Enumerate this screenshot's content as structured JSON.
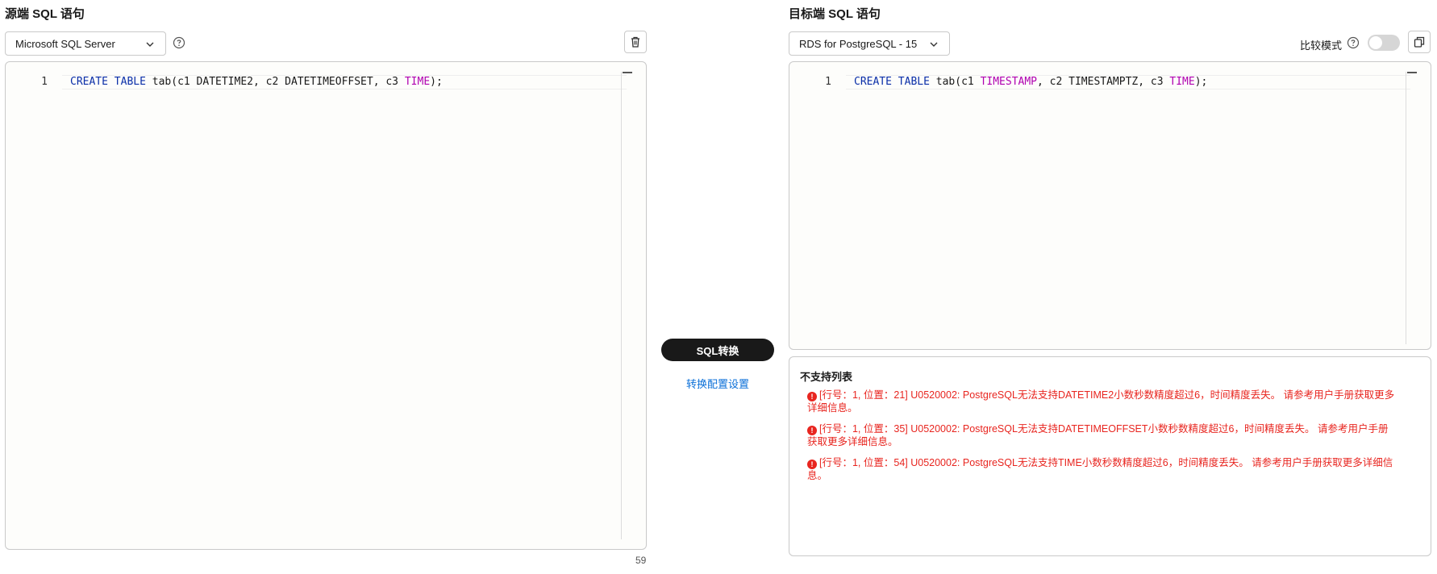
{
  "source": {
    "title": "源端 SQL 语句",
    "db_select": "Microsoft SQL Server",
    "line_number": "1",
    "code_tokens": [
      {
        "text": "CREATE",
        "kind": "kw"
      },
      {
        "text": " ",
        "kind": "plain"
      },
      {
        "text": "TABLE",
        "kind": "kw"
      },
      {
        "text": " tab(c1 DATETIME2, c2 DATETIMEOFFSET, c3 ",
        "kind": "plain"
      },
      {
        "text": "TIME",
        "kind": "type"
      },
      {
        "text": ");",
        "kind": "plain"
      }
    ],
    "char_count": "59"
  },
  "target": {
    "title": "目标端 SQL 语句",
    "db_select": "RDS for PostgreSQL - 15",
    "compare_mode_label": "比较模式",
    "compare_mode_on": false,
    "line_number": "1",
    "code_tokens": [
      {
        "text": "CREATE",
        "kind": "kw"
      },
      {
        "text": " ",
        "kind": "plain"
      },
      {
        "text": "TABLE",
        "kind": "kw"
      },
      {
        "text": " tab(c1 ",
        "kind": "plain"
      },
      {
        "text": "TIMESTAMP",
        "kind": "type"
      },
      {
        "text": ", c2 TIMESTAMPTZ, c3 ",
        "kind": "plain"
      },
      {
        "text": "TIME",
        "kind": "type"
      },
      {
        "text": ");",
        "kind": "plain"
      }
    ]
  },
  "actions": {
    "convert_label": "SQL转换",
    "config_link": "转换配置设置"
  },
  "issues": {
    "title": "不支持列表",
    "items": [
      "[行号：1, 位置：21] U0520002: PostgreSQL无法支持DATETIME2小数秒数精度超过6，时间精度丢失。 请参考用户手册获取更多详细信息。",
      "[行号：1, 位置：35] U0520002: PostgreSQL无法支持DATETIMEOFFSET小数秒数精度超过6，时间精度丢失。 请参考用户手册获取更多详细信息。",
      "[行号：1, 位置：54] U0520002: PostgreSQL无法支持TIME小数秒数精度超过6，时间精度丢失。 请参考用户手册获取更多详细信息。"
    ]
  },
  "colors": {
    "keyword": "#0a2ea8",
    "type": "#b000b0",
    "error": "#e8251f",
    "link": "#0a6fd8",
    "primary_button": "#191919"
  },
  "icons": {
    "select_arrow": "chevron-down-icon",
    "help": "question-circle-icon",
    "clear": "trash-icon",
    "copy": "copy-icon",
    "error": "exclamation-circle-icon"
  }
}
